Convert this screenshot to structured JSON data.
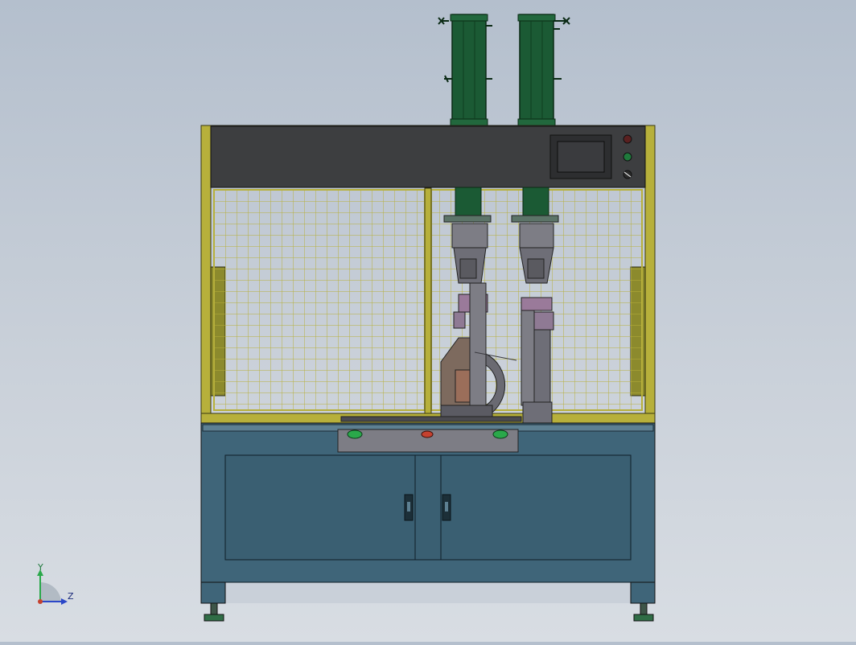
{
  "triad": {
    "y_label": "Y",
    "z_label": "Z"
  },
  "colors": {
    "background_top": "#b4bfcd",
    "background_bottom": "#d8dde3",
    "frame_yellow": "#b7b03b",
    "panel_dark": "#3d3e40",
    "cabinet_blue": "#3f6579",
    "cylinder_green": "#1b5a34",
    "fixture_gray": "#7d7d85",
    "button_green": "#2aa84a",
    "button_red": "#c5412f"
  },
  "machine": {
    "control_panel": {
      "screen": "hmi-touchscreen",
      "indicators": [
        "red-indicator",
        "green-indicator",
        "selector-switch"
      ]
    },
    "operator_buttons": [
      "green-start-button",
      "red-stop-button",
      "green-start-button"
    ],
    "cabinet": {
      "doors": 2,
      "handles": 2
    }
  }
}
